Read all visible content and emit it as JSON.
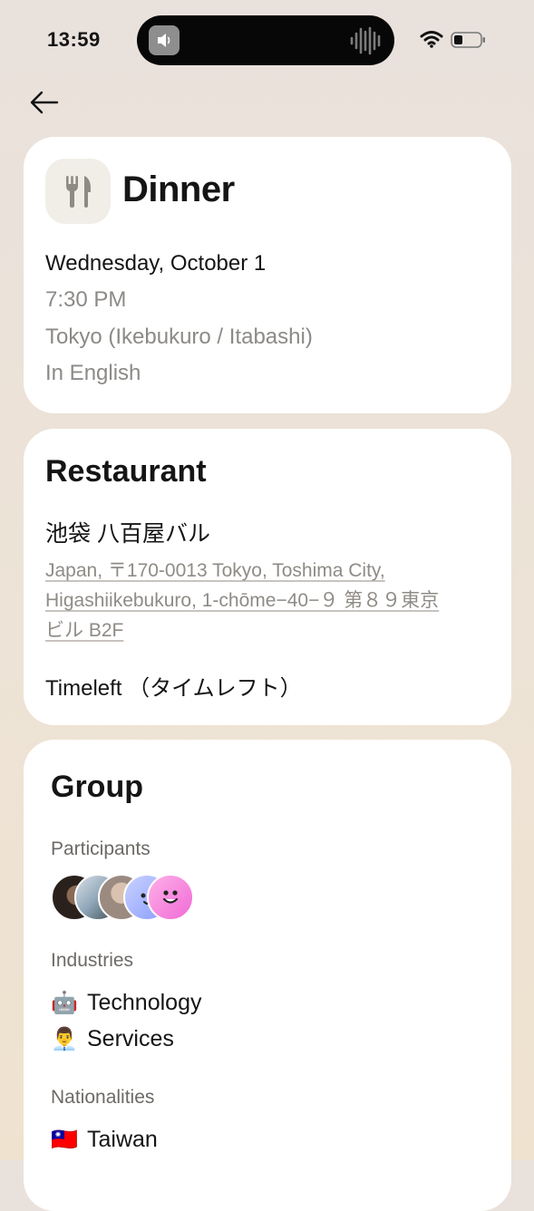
{
  "status_bar": {
    "time": "13:59"
  },
  "event": {
    "title": "Dinner",
    "icon": "fork-knife-icon",
    "date": "Wednesday, October 1",
    "time": "7:30 PM",
    "location": "Tokyo (Ikebukuro / Itabashi)",
    "language": "In English"
  },
  "restaurant": {
    "section_title": "Restaurant",
    "name": "池袋 八百屋バル",
    "address_line1": "Japan, 〒170-0013 Tokyo, Toshima City,",
    "address_line2": "Higashiikebukuro, 1-chōme−40−９ 第８９東京",
    "address_line3": "ビル B2F",
    "organizer": "Timeleft （タイムレフト）"
  },
  "group": {
    "section_title": "Group",
    "participants_label": "Participants",
    "industries_label": "Industries",
    "industries": [
      {
        "emoji": "🤖",
        "label": "Technology"
      },
      {
        "emoji": "👨‍💼",
        "label": "Services"
      }
    ],
    "nationalities_label": "Nationalities",
    "nationalities": [
      {
        "emoji": "🇹🇼",
        "label": "Taiwan"
      }
    ]
  },
  "colors": {
    "accent_text": "#151515",
    "muted_text": "#8c8a86",
    "card": "#ffffff"
  }
}
